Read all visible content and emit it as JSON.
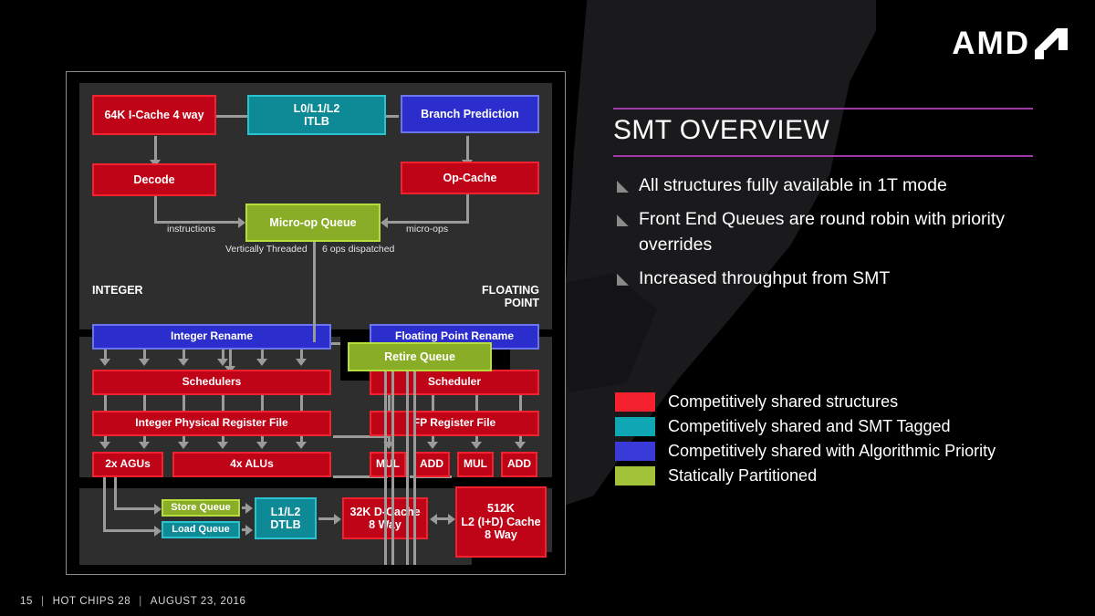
{
  "brand": {
    "name": "AMD",
    "logo_mark": "amd-arrow-mark"
  },
  "header": {
    "title": "SMT OVERVIEW",
    "accent_color": "#9e3aa8"
  },
  "bullets": [
    "All structures fully available in 1T mode",
    "Front End Queues are round robin with priority overrides",
    "Increased throughput from SMT"
  ],
  "legend": {
    "items": [
      {
        "label": "Competitively shared structures",
        "color": "#f4222f"
      },
      {
        "label": "Competitively shared and SMT Tagged",
        "color": "#0fa7b4"
      },
      {
        "label": "Competitively shared with Algorithmic Priority",
        "color": "#3a3ad8"
      },
      {
        "label": "Statically Partitioned",
        "color": "#a2c23a"
      }
    ]
  },
  "footer": {
    "page_number": "15",
    "separator": "|",
    "event": "HOT CHIPS 28",
    "date": "AUGUST 23, 2016"
  },
  "diagram": {
    "frontend": {
      "icache": "64K I-Cache 4 way",
      "itlb_line1": "L0/L1/L2",
      "itlb_line2": "ITLB",
      "branch_prediction": "Branch Prediction",
      "decode": "Decode",
      "op_cache": "Op-Cache",
      "microop_queue": "Micro-op Queue",
      "label_instructions": "instructions",
      "label_microops": "micro-ops",
      "label_vertically_threaded": "Vertically Threaded",
      "label_ops_dispatched": "6 ops dispatched"
    },
    "exec": {
      "retire_queue": "Retire Queue",
      "integer_header": "INTEGER",
      "fp_header_line1": "FLOATING",
      "fp_header_line2": "POINT",
      "integer_rename": "Integer Rename",
      "integer_schedulers": "Schedulers",
      "integer_prf": "Integer Physical Register File",
      "agus": "2x AGUs",
      "alus": "4x ALUs",
      "fp_rename": "Floating Point Rename",
      "fp_scheduler": "Scheduler",
      "fp_register_file": "FP Register File",
      "fp_units": [
        "MUL",
        "ADD",
        "MUL",
        "ADD"
      ]
    },
    "memory": {
      "store_queue": "Store Queue",
      "load_queue": "Load Queue",
      "dtlb_line1": "L1/L2",
      "dtlb_line2": "DTLB",
      "dcache_line1": "32K D-Cache",
      "dcache_line2": "8 Way",
      "l2_line1": "512K",
      "l2_line2": "L2 (I+D) Cache",
      "l2_line3": "8 Way"
    }
  }
}
